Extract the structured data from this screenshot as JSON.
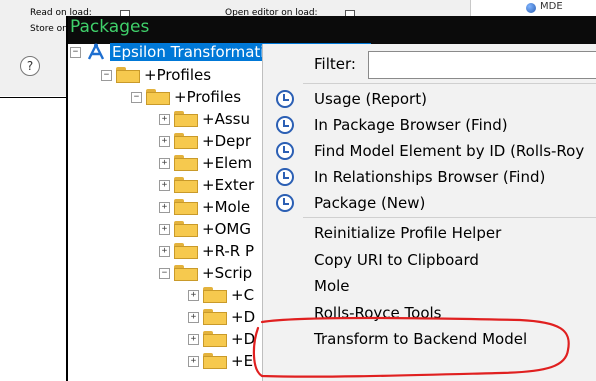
{
  "background_dialog": {
    "read_on_load": "Read on load:",
    "open_editor_on_load": "Open editor on load:",
    "store_on": "Store on",
    "help_glyph": "?",
    "mde_label": "MDE"
  },
  "packages_window": {
    "title": "Packages"
  },
  "tree": [
    {
      "label": "Epsilon Transformation Implement",
      "expander": "−",
      "icon": "model-a-icon",
      "selected": true
    },
    {
      "label": "+Profiles",
      "expander": "−",
      "icon": "folder-icon"
    },
    {
      "label": "+Profiles",
      "expander": "−",
      "icon": "folder-icon"
    },
    {
      "label": "+Assu",
      "expander": "+",
      "icon": "folder-icon"
    },
    {
      "label": "+Depr",
      "expander": "+",
      "icon": "folder-icon"
    },
    {
      "label": "+Elem",
      "expander": "+",
      "icon": "folder-icon"
    },
    {
      "label": "+Exter",
      "expander": "+",
      "icon": "folder-icon"
    },
    {
      "label": "+Mole",
      "expander": "+",
      "icon": "folder-icon"
    },
    {
      "label": "+OMG",
      "expander": "+",
      "icon": "folder-icon"
    },
    {
      "label": "+R-R P",
      "expander": "+",
      "icon": "folder-icon"
    },
    {
      "label": "+Scrip",
      "expander": "−",
      "icon": "folder-icon"
    },
    {
      "label": "+C",
      "expander": "+",
      "icon": "folder-icon"
    },
    {
      "label": "+D",
      "expander": "+",
      "icon": "folder-icon"
    },
    {
      "label": "+D",
      "expander": "+",
      "icon": "folder-icon"
    },
    {
      "label": "+E",
      "expander": "+",
      "icon": "folder-icon"
    }
  ],
  "context_menu": {
    "filter_label": "Filter:",
    "filter_value": "",
    "items": [
      {
        "label": "Usage (Report)",
        "icon": "clock-icon"
      },
      {
        "label": "In Package Browser (Find)",
        "icon": "clock-icon"
      },
      {
        "label": "Find Model Element by ID (Rolls-Roy",
        "icon": "clock-icon"
      },
      {
        "label": "In Relationships Browser (Find)",
        "icon": "clock-icon"
      },
      {
        "label": "Package (New)",
        "icon": "clock-icon"
      },
      {
        "label": "Reinitialize Profile Helper",
        "icon": ""
      },
      {
        "label": "Copy URI to Clipboard",
        "icon": ""
      },
      {
        "label": "Mole",
        "icon": ""
      },
      {
        "label": "Rolls-Royce Tools",
        "icon": ""
      },
      {
        "label": "Transform to Backend Model",
        "icon": "",
        "annotated": true
      }
    ]
  },
  "colors": {
    "title_bar": "#0b0b0b",
    "title_text": "#3fd06a",
    "selection": "#0078d7",
    "annotation": "#e02020",
    "menu_bg": "#f2f2f2"
  }
}
